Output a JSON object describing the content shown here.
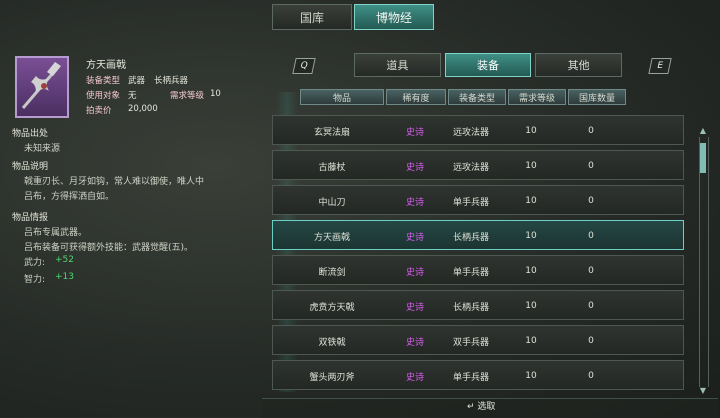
{
  "top_tabs": [
    "国库",
    "博物经"
  ],
  "sub_tabs": [
    "道具",
    "装备",
    "其他"
  ],
  "left_key": "Q",
  "right_key": "E",
  "item": {
    "name": "方天画戟",
    "type_label": "装备类型",
    "type_value_a": "武器",
    "type_value_b": "长柄兵器",
    "target_label": "使用对象",
    "target_value": "无",
    "required_label": "需求等级",
    "required_value": "10",
    "price_label": "拍卖价",
    "price_value": "20,000"
  },
  "source_title": "物品出处",
  "source_text": "未知来源",
  "description_title": "物品说明",
  "description_line1": "戟重刃长、月牙如钩，常人难以御使，唯人中",
  "description_line2": "吕布，方得挥洒自如。",
  "info_title": "物品情报",
  "info_line1": "吕布专属武器。",
  "info_line2": "吕布装备可获得额外技能：武器觉醒(五)。",
  "stat1_label": "武力:",
  "stat1_value": "+52",
  "stat2_label": "智力:",
  "stat2_value": "+13",
  "table": {
    "headers": [
      "物品",
      "稀有度",
      "装备类型",
      "需求等级",
      "国库数量"
    ],
    "rows": [
      {
        "name": "玄冥法扇",
        "rarity": "史诗",
        "type": "远攻法器",
        "level": "10",
        "count": "0"
      },
      {
        "name": "古藤杖",
        "rarity": "史诗",
        "type": "远攻法器",
        "level": "10",
        "count": "0"
      },
      {
        "name": "中山刀",
        "rarity": "史诗",
        "type": "单手兵器",
        "level": "10",
        "count": "0"
      },
      {
        "name": "方天画戟",
        "rarity": "史诗",
        "type": "长柄兵器",
        "level": "10",
        "count": "0"
      },
      {
        "name": "断流剑",
        "rarity": "史诗",
        "type": "单手兵器",
        "level": "10",
        "count": "0"
      },
      {
        "name": "虎贲方天戟",
        "rarity": "史诗",
        "type": "长柄兵器",
        "level": "10",
        "count": "0"
      },
      {
        "name": "双铁戟",
        "rarity": "史诗",
        "type": "双手兵器",
        "level": "10",
        "count": "0"
      },
      {
        "name": "蟹头两刃斧",
        "rarity": "史诗",
        "type": "单手兵器",
        "level": "10",
        "count": "0"
      }
    ]
  },
  "confirm_label": "选取",
  "confirm_key": "↵"
}
